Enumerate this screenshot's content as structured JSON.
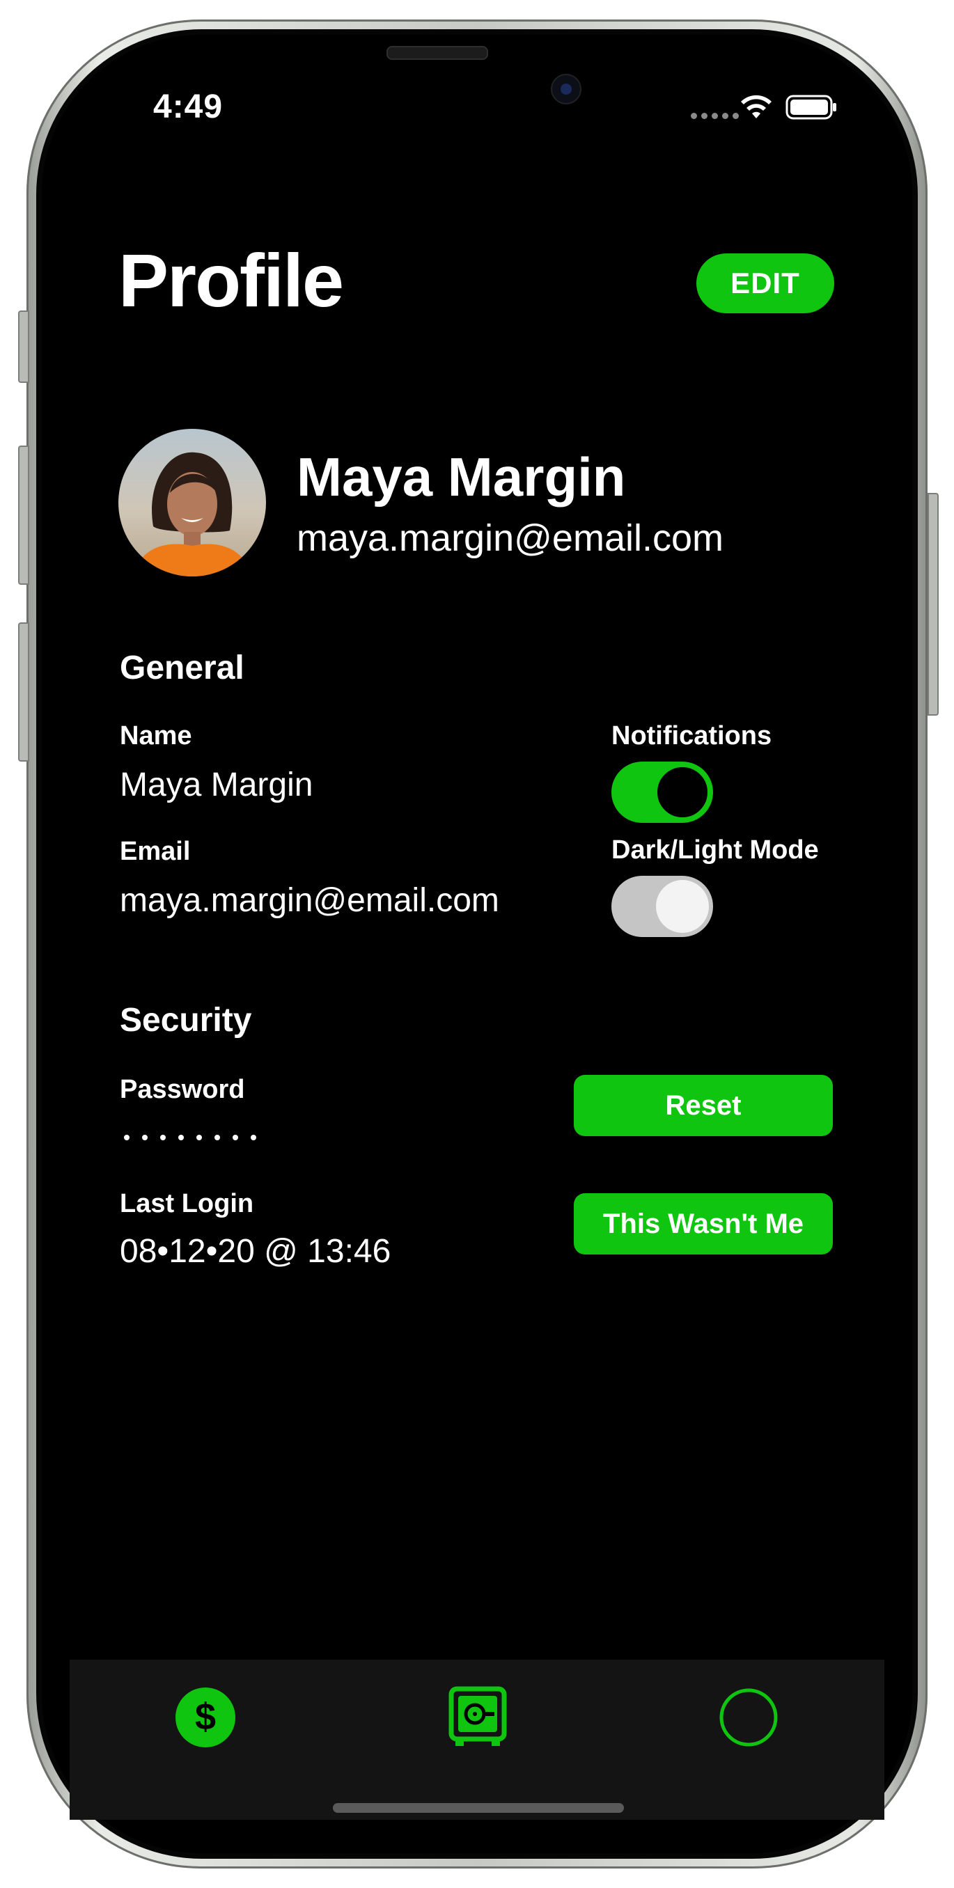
{
  "status_bar": {
    "time": "4:49"
  },
  "header": {
    "title": "Profile",
    "edit_label": "EDIT"
  },
  "profile": {
    "name": "Maya Margin",
    "email": "maya.margin@email.com"
  },
  "general": {
    "title": "General",
    "name_label": "Name",
    "name_value": "Maya Margin",
    "email_label": "Email",
    "email_value": "maya.margin@email.com",
    "notifications_label": "Notifications",
    "notifications_on": true,
    "mode_label": "Dark/Light Mode",
    "mode_on": false
  },
  "security": {
    "title": "Security",
    "password_label": "Password",
    "password_dots": 8,
    "reset_label": "Reset",
    "last_login_label": "Last Login",
    "last_login_value": "08•12•20 @ 13:46",
    "not_me_label": "This Wasn't Me"
  },
  "tab_bar": {
    "tabs": [
      "dollar-icon",
      "safe-icon",
      "circle-icon"
    ]
  },
  "colors": {
    "accent": "#10c510",
    "background": "#000000",
    "tab_bar": "#141414",
    "toggle_off": "#c5c5c5"
  }
}
